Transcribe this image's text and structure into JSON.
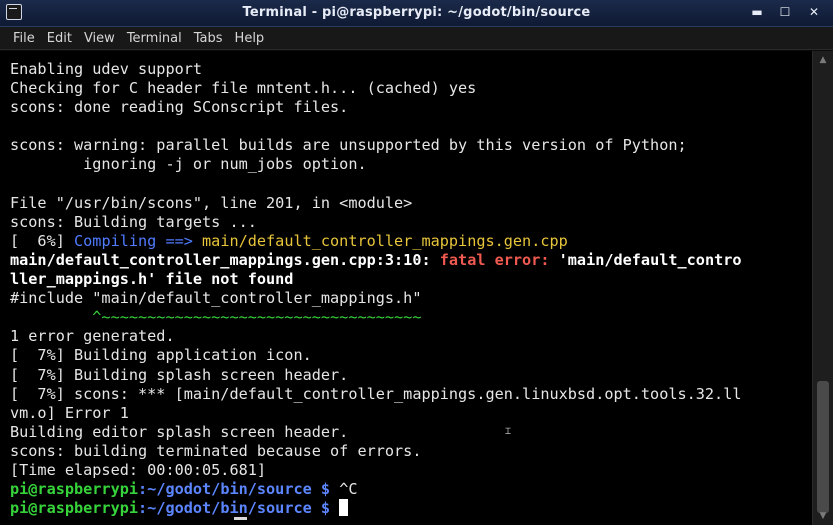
{
  "window": {
    "title": "Terminal - pi@raspberrypi: ~/godot/bin/source",
    "minimize_glyph": "▬",
    "maximize_glyph": "☐",
    "close_glyph": "✕"
  },
  "menu": [
    "File",
    "Edit",
    "View",
    "Terminal",
    "Tabs",
    "Help"
  ],
  "colors": {
    "titlebar": "#1b2a4a",
    "terminal_bg": "#000000",
    "text": "#e6e6e6",
    "error_red": "#f05a50",
    "compile_blue": "#4f7cff",
    "path_yellow": "#e8c53a",
    "caret_green": "#36d33a"
  },
  "terminal": {
    "lines": [
      [
        {
          "t": "Enabling udev support"
        }
      ],
      [
        {
          "t": "Checking for C header file mntent.h... (cached) yes"
        }
      ],
      [
        {
          "t": "scons: done reading SConscript files."
        }
      ],
      [
        {
          "t": ""
        }
      ],
      [
        {
          "t": "scons: warning: parallel builds are unsupported by this version of Python;"
        }
      ],
      [
        {
          "t": "        ignoring -j or num_jobs option."
        }
      ],
      [
        {
          "t": ""
        }
      ],
      [
        {
          "t": "File \"/usr/bin/scons\", line 201, in <module>"
        }
      ],
      [
        {
          "t": "scons: Building targets ..."
        }
      ],
      [
        {
          "t": "[  6%] "
        },
        {
          "t": "Compiling ==> ",
          "c": "blue"
        },
        {
          "t": "main/default_controller_mappings.gen.cpp",
          "c": "yellow"
        }
      ],
      [
        {
          "t": "main/default_controller_mappings.gen.cpp:3:10: ",
          "c": "bold"
        },
        {
          "t": "fatal error: ",
          "c": "red"
        },
        {
          "t": "'main/default_contro",
          "c": "bold"
        }
      ],
      [
        {
          "t": "ller_mappings.h' file not found",
          "c": "bold"
        }
      ],
      [
        {
          "t": "#include \"main/default_controller_mappings.h\""
        }
      ],
      [
        {
          "t": "         ^~~~~~~~~~~~~~~~~~~~~~~~~~~~~~~~~~~~",
          "c": "green"
        }
      ],
      [
        {
          "t": "1 error generated."
        }
      ],
      [
        {
          "t": "[  7%] Building application icon."
        }
      ],
      [
        {
          "t": "[  7%] Building splash screen header."
        }
      ],
      [
        {
          "t": "[  7%] scons: *** [main/default_controller_mappings.gen.linuxbsd.opt.tools.32.ll"
        }
      ],
      [
        {
          "t": "vm.o] Error 1"
        }
      ],
      [
        {
          "t": "Building editor splash screen header."
        }
      ],
      [
        {
          "t": "scons: building terminated because of errors."
        }
      ],
      [
        {
          "t": "[Time elapsed: 00:00:05.681]"
        }
      ],
      [
        {
          "t": "pi@raspberrypi",
          "c": "prompt-user"
        },
        {
          "t": ":",
          "c": "prompt-path"
        },
        {
          "t": "~/godot/bin/source $",
          "c": "prompt-path"
        },
        {
          "t": " ^C"
        }
      ],
      [
        {
          "t": "pi@raspberrypi",
          "c": "prompt-user"
        },
        {
          "t": ":",
          "c": "prompt-path"
        },
        {
          "t": "~/godot/bin/source $",
          "c": "prompt-path"
        },
        {
          "t": " "
        },
        {
          "cursor": true
        }
      ]
    ]
  }
}
